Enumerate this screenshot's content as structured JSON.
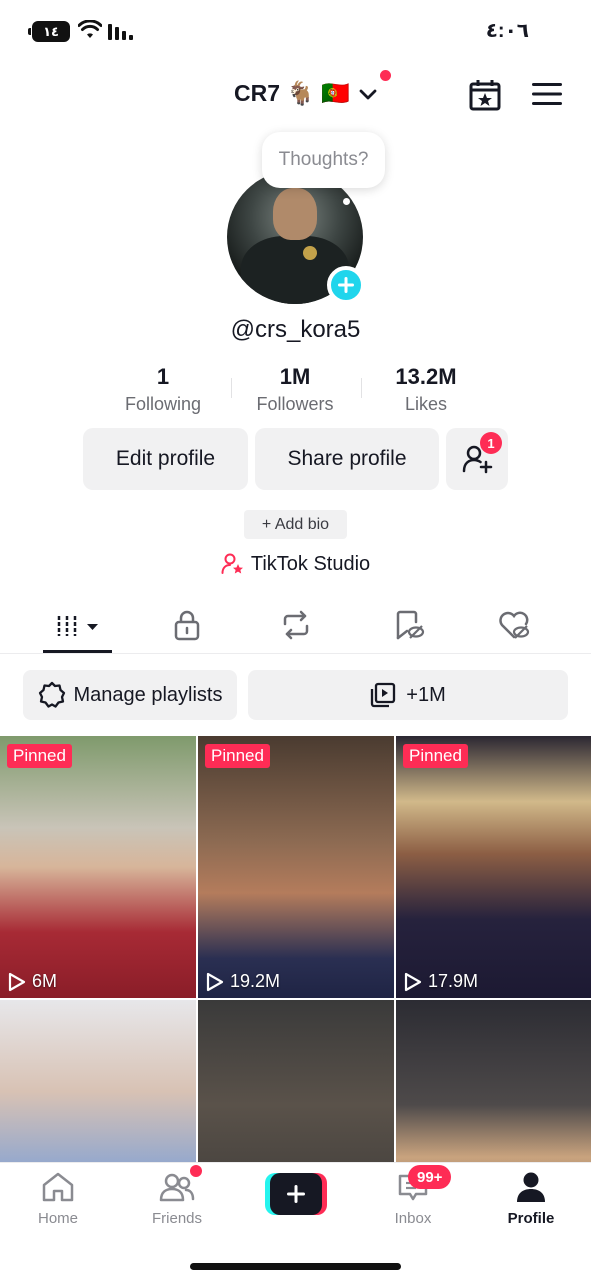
{
  "status_bar": {
    "battery": "١٤",
    "time": "٤:٠٦"
  },
  "header": {
    "title": "CR7 🐐 🇵🇹",
    "calendar_icon": "calendar-star-icon",
    "menu_icon": "hamburger-menu-icon"
  },
  "profile": {
    "thoughts_placeholder": "Thoughts?",
    "username": "@crs_kora5",
    "stats": [
      {
        "value": "1",
        "label": "Following"
      },
      {
        "value": "1M",
        "label": "Followers"
      },
      {
        "value": "13.2M",
        "label": "Likes"
      }
    ],
    "edit_label": "Edit profile",
    "share_label": "Share profile",
    "friend_requests": "1",
    "add_bio": "+ Add bio",
    "studio": "TikTok Studio"
  },
  "playlists": {
    "manage_label": "Manage playlists",
    "count_label": "+1M"
  },
  "videos": [
    {
      "pinned": "Pinned",
      "views": "6M"
    },
    {
      "pinned": "Pinned",
      "views": "19.2M"
    },
    {
      "pinned": "Pinned",
      "views": "17.9M"
    },
    {
      "pinned": "",
      "views": ""
    },
    {
      "pinned": "",
      "views": ""
    },
    {
      "pinned": "",
      "views": ""
    }
  ],
  "nav": {
    "home": "Home",
    "friends": "Friends",
    "inbox": "Inbox",
    "inbox_badge": "99+",
    "profile": "Profile"
  },
  "colors": {
    "accent": "#fe2c55",
    "cyan": "#20d5ec",
    "button_bg": "#f1f1f2"
  }
}
